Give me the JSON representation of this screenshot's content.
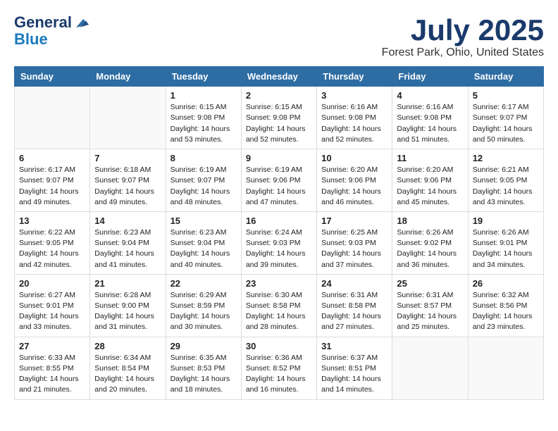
{
  "header": {
    "logo_general": "General",
    "logo_blue": "Blue",
    "month_title": "July 2025",
    "location": "Forest Park, Ohio, United States"
  },
  "columns": [
    "Sunday",
    "Monday",
    "Tuesday",
    "Wednesday",
    "Thursday",
    "Friday",
    "Saturday"
  ],
  "weeks": [
    [
      {
        "day": "",
        "info": ""
      },
      {
        "day": "",
        "info": ""
      },
      {
        "day": "1",
        "info": "Sunrise: 6:15 AM\nSunset: 9:08 PM\nDaylight: 14 hours and 53 minutes."
      },
      {
        "day": "2",
        "info": "Sunrise: 6:15 AM\nSunset: 9:08 PM\nDaylight: 14 hours and 52 minutes."
      },
      {
        "day": "3",
        "info": "Sunrise: 6:16 AM\nSunset: 9:08 PM\nDaylight: 14 hours and 52 minutes."
      },
      {
        "day": "4",
        "info": "Sunrise: 6:16 AM\nSunset: 9:08 PM\nDaylight: 14 hours and 51 minutes."
      },
      {
        "day": "5",
        "info": "Sunrise: 6:17 AM\nSunset: 9:07 PM\nDaylight: 14 hours and 50 minutes."
      }
    ],
    [
      {
        "day": "6",
        "info": "Sunrise: 6:17 AM\nSunset: 9:07 PM\nDaylight: 14 hours and 49 minutes."
      },
      {
        "day": "7",
        "info": "Sunrise: 6:18 AM\nSunset: 9:07 PM\nDaylight: 14 hours and 49 minutes."
      },
      {
        "day": "8",
        "info": "Sunrise: 6:19 AM\nSunset: 9:07 PM\nDaylight: 14 hours and 48 minutes."
      },
      {
        "day": "9",
        "info": "Sunrise: 6:19 AM\nSunset: 9:06 PM\nDaylight: 14 hours and 47 minutes."
      },
      {
        "day": "10",
        "info": "Sunrise: 6:20 AM\nSunset: 9:06 PM\nDaylight: 14 hours and 46 minutes."
      },
      {
        "day": "11",
        "info": "Sunrise: 6:20 AM\nSunset: 9:06 PM\nDaylight: 14 hours and 45 minutes."
      },
      {
        "day": "12",
        "info": "Sunrise: 6:21 AM\nSunset: 9:05 PM\nDaylight: 14 hours and 43 minutes."
      }
    ],
    [
      {
        "day": "13",
        "info": "Sunrise: 6:22 AM\nSunset: 9:05 PM\nDaylight: 14 hours and 42 minutes."
      },
      {
        "day": "14",
        "info": "Sunrise: 6:23 AM\nSunset: 9:04 PM\nDaylight: 14 hours and 41 minutes."
      },
      {
        "day": "15",
        "info": "Sunrise: 6:23 AM\nSunset: 9:04 PM\nDaylight: 14 hours and 40 minutes."
      },
      {
        "day": "16",
        "info": "Sunrise: 6:24 AM\nSunset: 9:03 PM\nDaylight: 14 hours and 39 minutes."
      },
      {
        "day": "17",
        "info": "Sunrise: 6:25 AM\nSunset: 9:03 PM\nDaylight: 14 hours and 37 minutes."
      },
      {
        "day": "18",
        "info": "Sunrise: 6:26 AM\nSunset: 9:02 PM\nDaylight: 14 hours and 36 minutes."
      },
      {
        "day": "19",
        "info": "Sunrise: 6:26 AM\nSunset: 9:01 PM\nDaylight: 14 hours and 34 minutes."
      }
    ],
    [
      {
        "day": "20",
        "info": "Sunrise: 6:27 AM\nSunset: 9:01 PM\nDaylight: 14 hours and 33 minutes."
      },
      {
        "day": "21",
        "info": "Sunrise: 6:28 AM\nSunset: 9:00 PM\nDaylight: 14 hours and 31 minutes."
      },
      {
        "day": "22",
        "info": "Sunrise: 6:29 AM\nSunset: 8:59 PM\nDaylight: 14 hours and 30 minutes."
      },
      {
        "day": "23",
        "info": "Sunrise: 6:30 AM\nSunset: 8:58 PM\nDaylight: 14 hours and 28 minutes."
      },
      {
        "day": "24",
        "info": "Sunrise: 6:31 AM\nSunset: 8:58 PM\nDaylight: 14 hours and 27 minutes."
      },
      {
        "day": "25",
        "info": "Sunrise: 6:31 AM\nSunset: 8:57 PM\nDaylight: 14 hours and 25 minutes."
      },
      {
        "day": "26",
        "info": "Sunrise: 6:32 AM\nSunset: 8:56 PM\nDaylight: 14 hours and 23 minutes."
      }
    ],
    [
      {
        "day": "27",
        "info": "Sunrise: 6:33 AM\nSunset: 8:55 PM\nDaylight: 14 hours and 21 minutes."
      },
      {
        "day": "28",
        "info": "Sunrise: 6:34 AM\nSunset: 8:54 PM\nDaylight: 14 hours and 20 minutes."
      },
      {
        "day": "29",
        "info": "Sunrise: 6:35 AM\nSunset: 8:53 PM\nDaylight: 14 hours and 18 minutes."
      },
      {
        "day": "30",
        "info": "Sunrise: 6:36 AM\nSunset: 8:52 PM\nDaylight: 14 hours and 16 minutes."
      },
      {
        "day": "31",
        "info": "Sunrise: 6:37 AM\nSunset: 8:51 PM\nDaylight: 14 hours and 14 minutes."
      },
      {
        "day": "",
        "info": ""
      },
      {
        "day": "",
        "info": ""
      }
    ]
  ]
}
